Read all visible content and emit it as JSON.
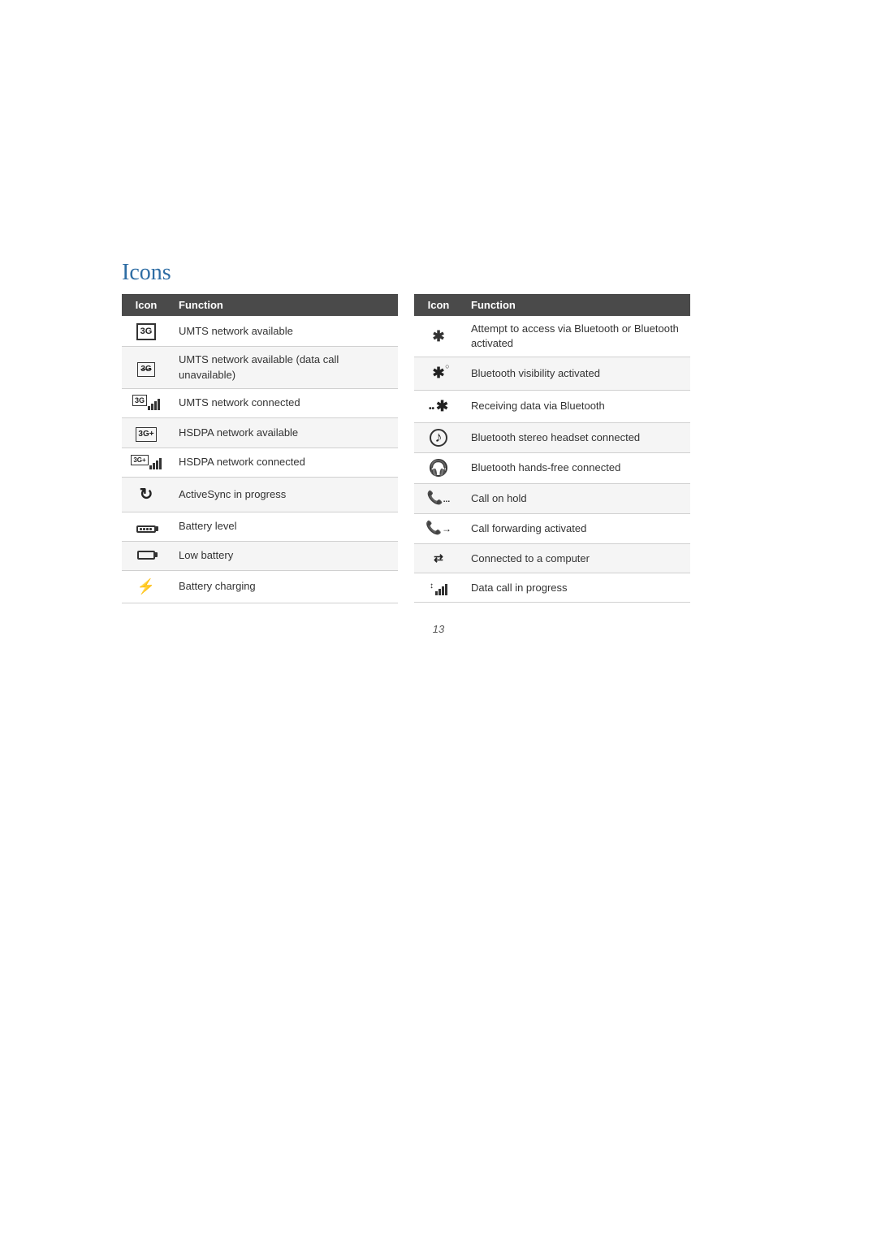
{
  "page": {
    "title": "Icons",
    "page_number": "13"
  },
  "left_table": {
    "headers": [
      "Icon",
      "Function"
    ],
    "rows": [
      {
        "icon_type": "3g-box",
        "icon_label": "3G",
        "function": "UMTS network available"
      },
      {
        "icon_type": "3g-box-alt",
        "icon_label": "3G",
        "function": "UMTS network available (data call unavailable)"
      },
      {
        "icon_type": "3g-bars",
        "icon_label": "3G+bars",
        "function": "UMTS network connected"
      },
      {
        "icon_type": "3gplus-box",
        "icon_label": "3G+",
        "function": "HSDPA network available"
      },
      {
        "icon_type": "3gplus-bars",
        "icon_label": "3G+bars2",
        "function": "HSDPA network connected"
      },
      {
        "icon_type": "sync",
        "icon_label": "sync",
        "function": "ActiveSync in progress"
      },
      {
        "icon_type": "battery-full",
        "icon_label": "battery",
        "function": "Battery level"
      },
      {
        "icon_type": "battery-low",
        "icon_label": "battery-low",
        "function": "Low battery"
      },
      {
        "icon_type": "battery-charge",
        "icon_label": "battery-charge",
        "function": "Battery charging"
      }
    ]
  },
  "right_table": {
    "headers": [
      "Icon",
      "Function"
    ],
    "rows": [
      {
        "icon_type": "bt-access",
        "icon_label": "bluetooth",
        "function": "Attempt to access via Bluetooth or Bluetooth activated"
      },
      {
        "icon_type": "bt-visible",
        "icon_label": "bluetooth-visible",
        "function": "Bluetooth visibility activated"
      },
      {
        "icon_type": "bt-data",
        "icon_label": "bluetooth-data",
        "function": "Receiving data via Bluetooth"
      },
      {
        "icon_type": "bt-stereo",
        "icon_label": "bluetooth-stereo",
        "function": "Bluetooth stereo headset connected"
      },
      {
        "icon_type": "bt-handsfree",
        "icon_label": "bluetooth-handsfree",
        "function": "Bluetooth hands-free connected"
      },
      {
        "icon_type": "call-hold",
        "icon_label": "call-hold",
        "function": "Call on hold"
      },
      {
        "icon_type": "call-forward",
        "icon_label": "call-forward",
        "function": "Call forwarding activated"
      },
      {
        "icon_type": "computer",
        "icon_label": "computer-connected",
        "function": "Connected to a computer"
      },
      {
        "icon_type": "data-call",
        "icon_label": "data-call",
        "function": "Data call in progress"
      }
    ]
  }
}
